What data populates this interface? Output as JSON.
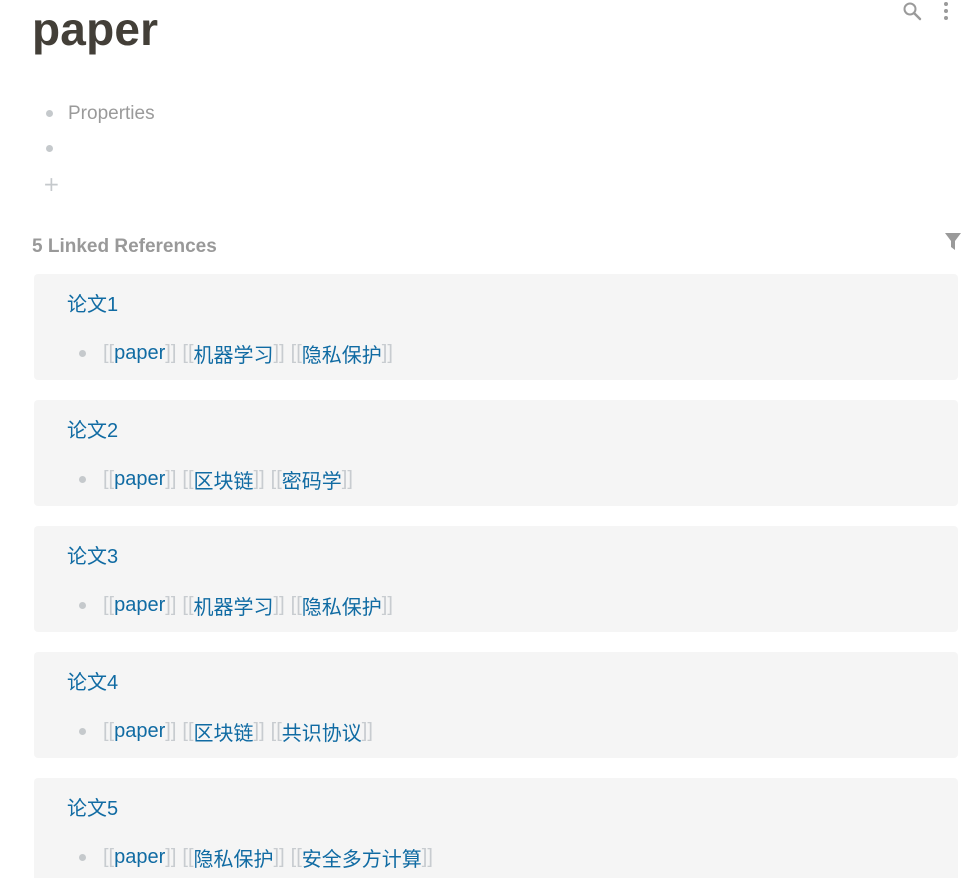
{
  "page": {
    "title": "paper"
  },
  "top_actions": {
    "icons": [
      "search-icon",
      "more-vertical-icon"
    ]
  },
  "blocks": [
    {
      "text": "Properties"
    },
    {
      "text": ""
    }
  ],
  "add_block_glyph": "+",
  "linked_references": {
    "title": "5 Linked References",
    "filter_icon": "filter-icon",
    "bracket_open": "[[",
    "bracket_close": "]]",
    "items": [
      {
        "page": "论文1",
        "tags": [
          "paper",
          "机器学习",
          "隐私保护"
        ]
      },
      {
        "page": "论文2",
        "tags": [
          "paper",
          "区块链",
          "密码学"
        ]
      },
      {
        "page": "论文3",
        "tags": [
          "paper",
          "机器学习",
          "隐私保护"
        ]
      },
      {
        "page": "论文4",
        "tags": [
          "paper",
          "区块链",
          "共识协议"
        ]
      },
      {
        "page": "论文5",
        "tags": [
          "paper",
          "隐私保护",
          "安全多方计算"
        ]
      }
    ]
  },
  "colors": {
    "link": "#106ba3",
    "bracket": "#c8ccd0",
    "card_bg": "#f5f5f5",
    "title": "#433f38",
    "muted": "#999999"
  }
}
